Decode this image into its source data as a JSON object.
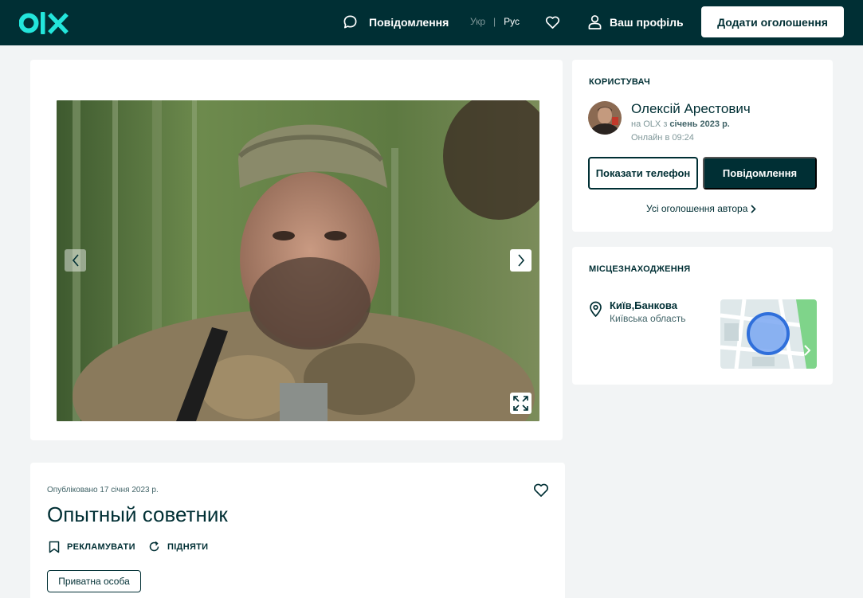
{
  "header": {
    "messages_label": "Повідомлення",
    "lang_ukr": "Укр",
    "lang_separator": "|",
    "lang_rus": "Рус",
    "profile_label": "Ваш профіль",
    "add_ad_label": "Додати оголошення"
  },
  "gallery": {
    "prev_icon": "chevron-left-icon",
    "next_icon": "chevron-right-icon",
    "fullscreen_icon": "expand-icon"
  },
  "user": {
    "section_title": "КОРИСТУВАЧ",
    "name": "Олексій Арестович",
    "since_prefix": "на OLX з",
    "since_date": "січень 2023 р.",
    "online": "Онлайн в 09:24",
    "show_phone": "Показати телефон",
    "message_button": "Повідомлення",
    "all_ads": "Усі оголошення автора"
  },
  "location": {
    "section_title": "МІСЦЕЗНАХОДЖЕННЯ",
    "city": "Київ,Банкова",
    "region": "Київська область"
  },
  "ad": {
    "published": "Опубліковано 17 січня 2023 р.",
    "title": "Опытный советник",
    "promote_label": "РЕКЛАМУВАТИ",
    "raise_label": "ПІДНЯТИ",
    "seller_type": "Приватна особа"
  },
  "colors": {
    "brand_dark": "#002f34",
    "accent_teal": "#23e5db",
    "background": "#f2f4f5"
  }
}
